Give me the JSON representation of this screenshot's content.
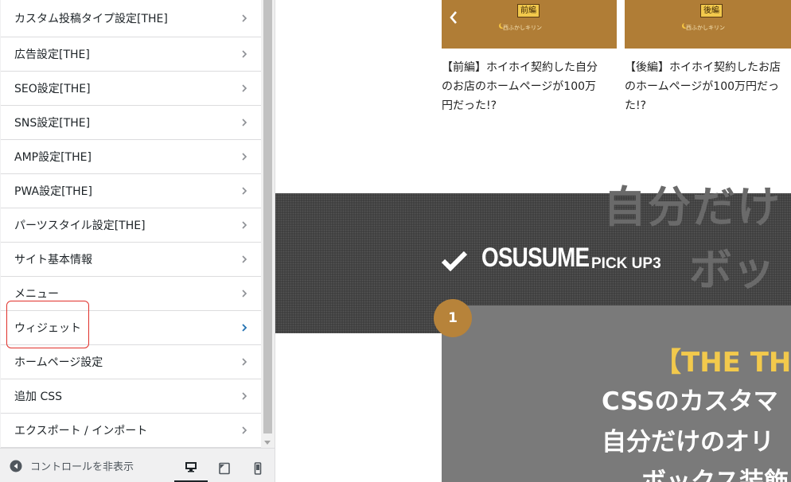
{
  "sidebar": {
    "items": [
      {
        "label": "カスタム投稿タイプ設定[THE]"
      },
      {
        "label": "広告設定[THE]"
      },
      {
        "label": "SEO設定[THE]"
      },
      {
        "label": "SNS設定[THE]"
      },
      {
        "label": "AMP設定[THE]"
      },
      {
        "label": "PWA設定[THE]"
      },
      {
        "label": "パーツスタイル設定[THE]"
      },
      {
        "label": "サイト基本情報"
      },
      {
        "label": "メニュー"
      },
      {
        "label": "ウィジェット"
      },
      {
        "label": "ホームページ設定"
      },
      {
        "label": "追加 CSS"
      },
      {
        "label": "エクスポート / インポート"
      }
    ],
    "active_item": "ウィジェット",
    "footer": {
      "collapse_label": "コントロールを非表示",
      "devices": [
        "desktop",
        "tablet",
        "mobile"
      ],
      "active_device": "desktop"
    }
  },
  "preview": {
    "cards": [
      {
        "tag": "前編",
        "brand": "西ふかしキリン",
        "title": "【前編】ホイホイ契約した自分\nのお店のホームページが100万\n円だった!?"
      },
      {
        "tag": "後編",
        "brand": "西ふかしキリン",
        "title": "【後編】ホイホイ契約したお店\nのホームページが100万円だっ\nた!?"
      }
    ],
    "section": {
      "heading": "OSUSUME",
      "subheading": "PICK UP3",
      "bg_text_1": "自分だけ",
      "bg_text_2": "ボッ"
    },
    "feature": {
      "number": "1",
      "title_lines": [
        "【THE THO",
        "CSSのカスタマ",
        "自分だけのオリ",
        "ボックス装飾"
      ]
    }
  },
  "colors": {
    "accent": "#2271b1",
    "highlight": "#e0302a",
    "thumb": "#b07d36",
    "badge": "#b7833a",
    "title_yellow": "#f2c94c"
  }
}
